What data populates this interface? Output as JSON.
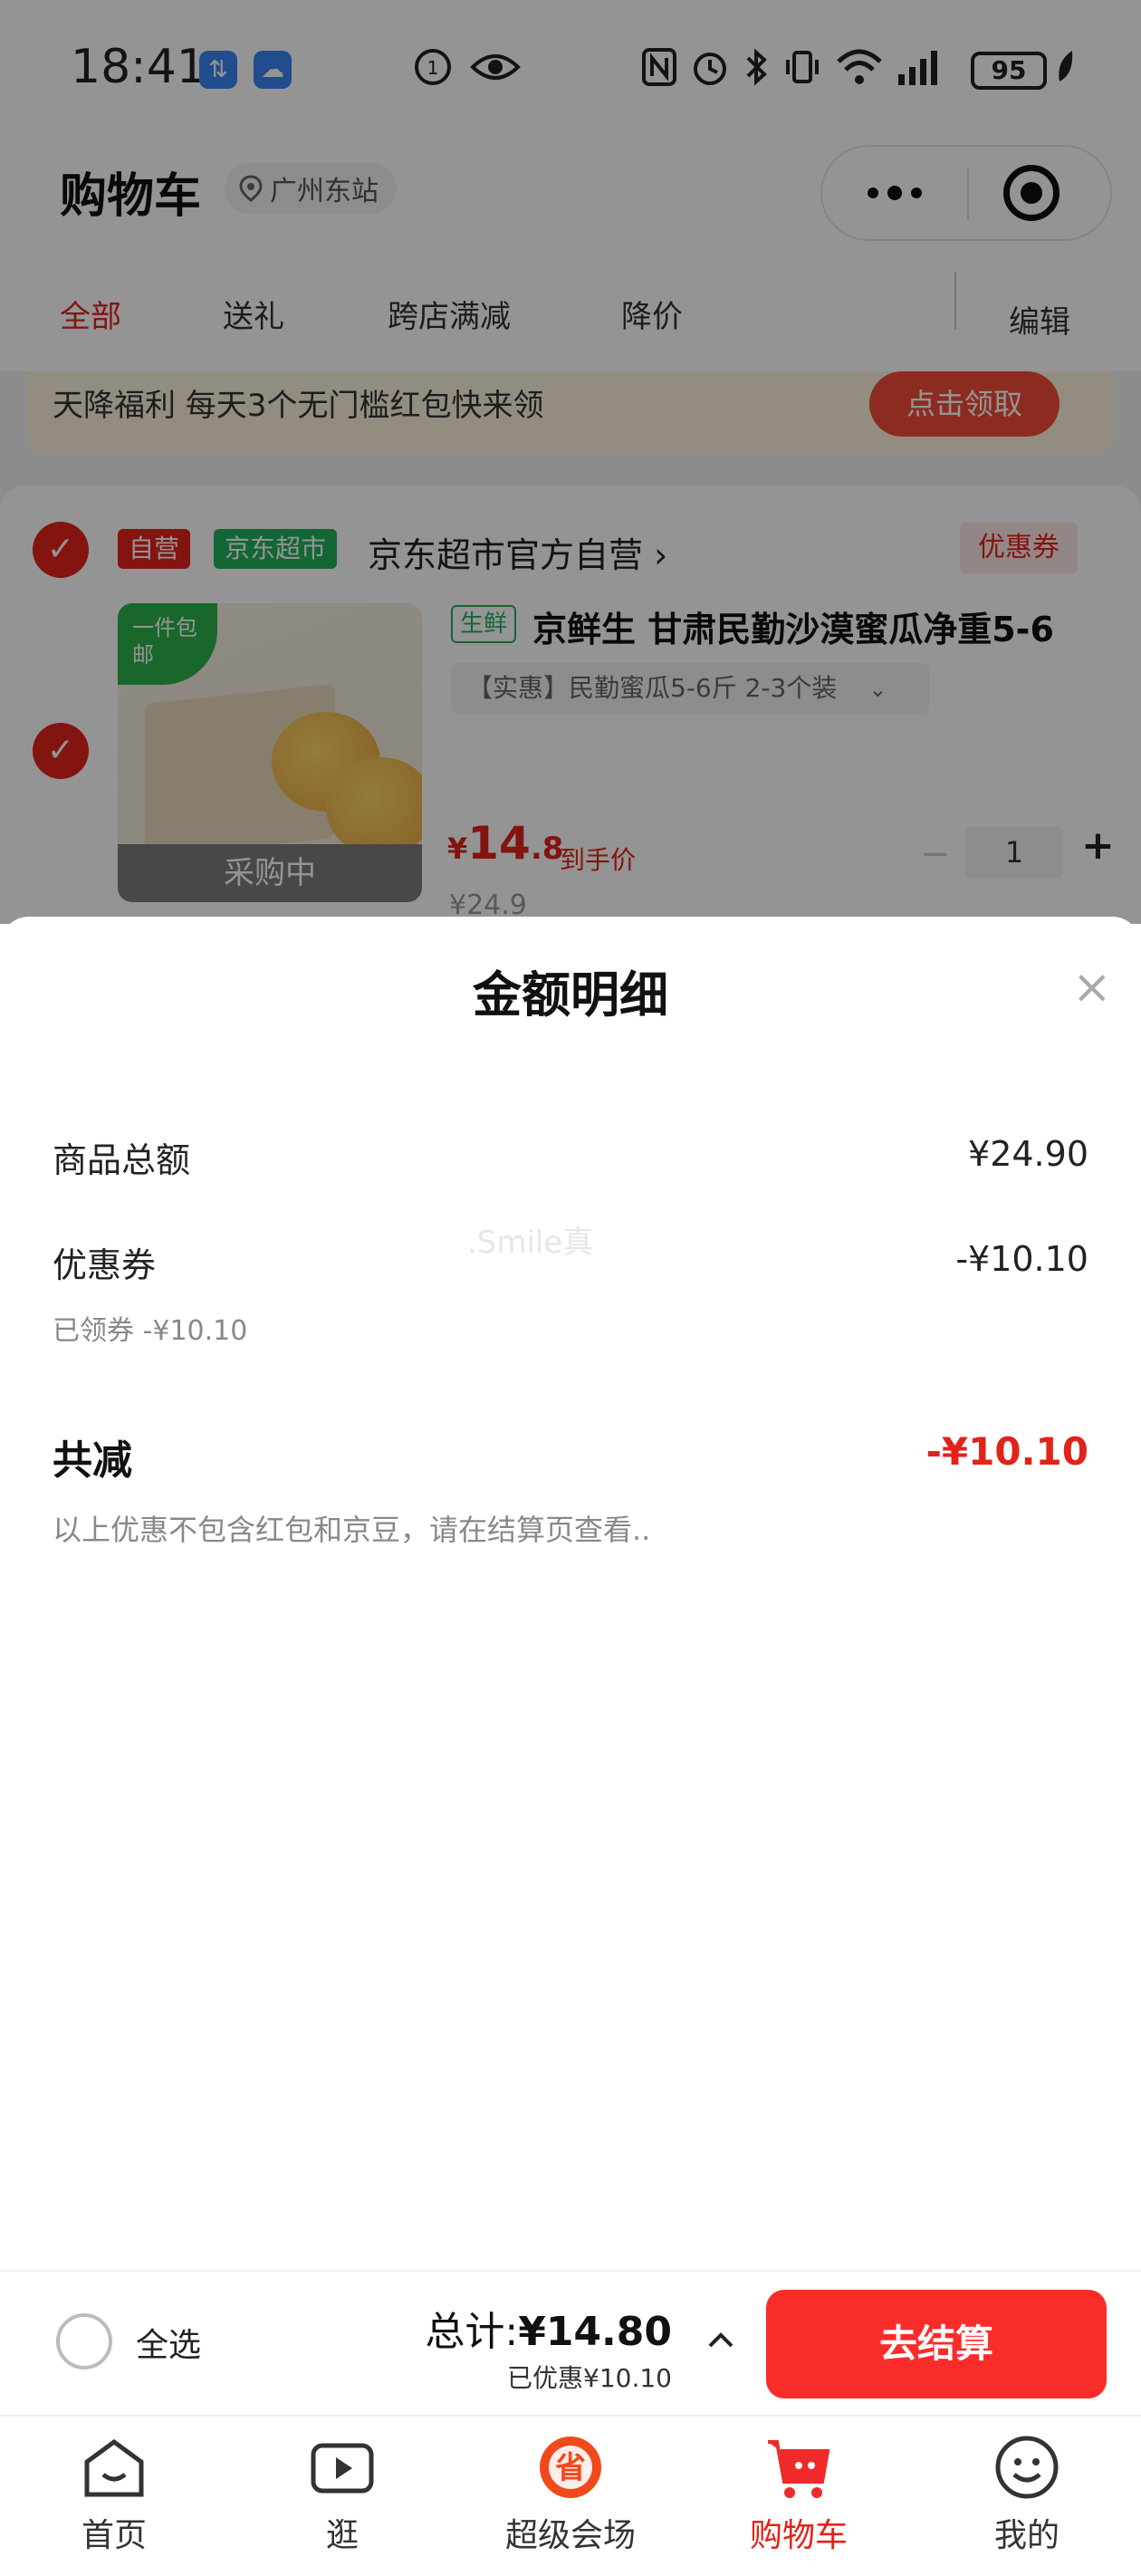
{
  "status_bar": {
    "time": "18:41",
    "battery": "95",
    "icons": [
      "data-transfer-icon",
      "weather-icon",
      "hd-icon",
      "eye-icon",
      "nfc-icon",
      "alarm-icon",
      "bluetooth-icon",
      "vibrate-icon",
      "wifi-icon",
      "signal-icon",
      "battery-icon",
      "leaf-icon"
    ]
  },
  "header": {
    "title": "购物车",
    "location": "广州东站",
    "tabs": [
      "全部",
      "送礼",
      "跨店满减",
      "降价"
    ],
    "active_tab": "全部",
    "edit": "编辑"
  },
  "banner": {
    "text": "天降福利 每天3个无门槛红包快来领",
    "button": "点击领取"
  },
  "store": {
    "tag_self": "自营",
    "tag_market": "京东超市",
    "name": "京东超市官方自营 ›",
    "coupon": "优惠券",
    "product": {
      "free_ship": "一件包邮",
      "status": "采购中",
      "fresh_tag": "生鲜",
      "name": "京鲜生 甘肃民勤沙漠蜜瓜净重5-6",
      "spec": "【实惠】民勤蜜瓜5-6斤 2-3个装",
      "price_currency": "¥",
      "price_int": "14",
      "price_dec": ".8",
      "price_label": "到手价",
      "price_old": "¥24.9",
      "quantity": "1",
      "minus": "−",
      "plus": "+"
    }
  },
  "sheet": {
    "title": "金额明细",
    "close": "×",
    "rows": [
      {
        "label": "商品总额",
        "value": "¥24.90"
      },
      {
        "label": "优惠券",
        "value": "-¥10.10"
      }
    ],
    "coupon_sub": "已领券 -¥10.10",
    "watermark": ".Smile真",
    "total_label": "共减",
    "total_value": "-¥10.10",
    "note": "以上优惠不包含红包和京豆，请在结算页查看.."
  },
  "checkout": {
    "select_all": "全选",
    "total_prefix": "总计:",
    "total_amount": "¥14.80",
    "saved": "已优惠¥10.10",
    "button": "去结算"
  },
  "nav": [
    {
      "label": "首页",
      "icon": "home-icon"
    },
    {
      "label": "逛",
      "icon": "video-play-icon"
    },
    {
      "label": "超级会场",
      "icon": "super-venue-icon"
    },
    {
      "label": "购物车",
      "icon": "cart-icon",
      "active": true
    },
    {
      "label": "我的",
      "icon": "profile-smile-icon"
    }
  ],
  "colors": {
    "brand_red": "#e2231a",
    "checkout_red": "#fa2c2a",
    "market_green": "#1fb15a",
    "banner_bg": "#fdf1de"
  }
}
